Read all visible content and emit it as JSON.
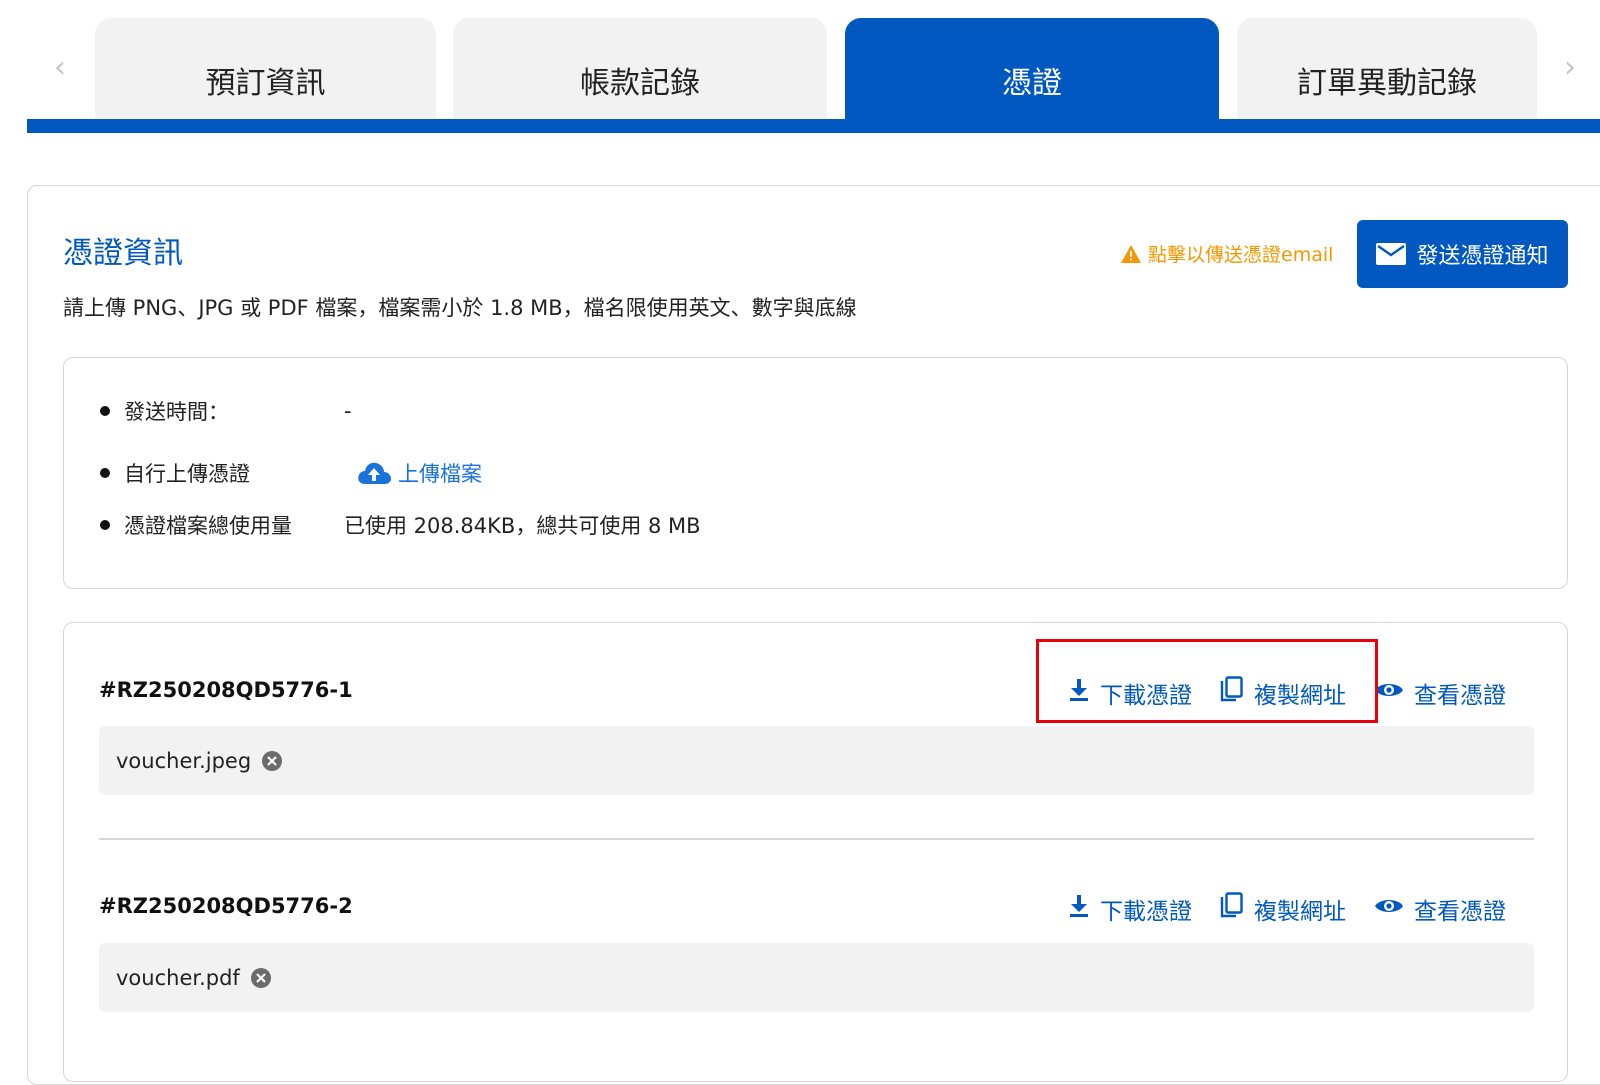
{
  "tabs": {
    "items": [
      {
        "label": "預訂資訊"
      },
      {
        "label": "帳款記錄"
      },
      {
        "label": "憑證"
      },
      {
        "label": "訂單異動記錄"
      }
    ],
    "active_index": 2,
    "prev_arrow": "‹",
    "next_arrow": "›"
  },
  "section": {
    "title": "憑證資訊",
    "notice": "點擊以傳送憑證email",
    "send_button": "發送憑證通知",
    "upload_hint": "請上傳 PNG、JPG 或 PDF 檔案，檔案需小於 1.8 MB，檔名限使用英文、數字與底線"
  },
  "info": {
    "send_time_label": "發送時間：",
    "send_time_value": "-",
    "self_upload_label": "自行上傳憑證",
    "upload_link": "上傳檔案",
    "usage_label": "憑證檔案總使用量",
    "usage_value": "已使用 208.84KB，總共可使用 8 MB"
  },
  "vouchers": [
    {
      "id": "#RZ250208QD5776-1",
      "file": "voucher.jpeg",
      "download": "下載憑證",
      "copy": "複製網址",
      "view": "查看憑證"
    },
    {
      "id": "#RZ250208QD5776-2",
      "file": "voucher.pdf",
      "download": "下載憑證",
      "copy": "複製網址",
      "view": "查看憑證"
    }
  ],
  "colors": {
    "primary": "#0058c0",
    "link": "#1a73d9",
    "warning": "#f39800",
    "highlight": "#e8000b",
    "tab_inactive": "#f2f2f2"
  }
}
